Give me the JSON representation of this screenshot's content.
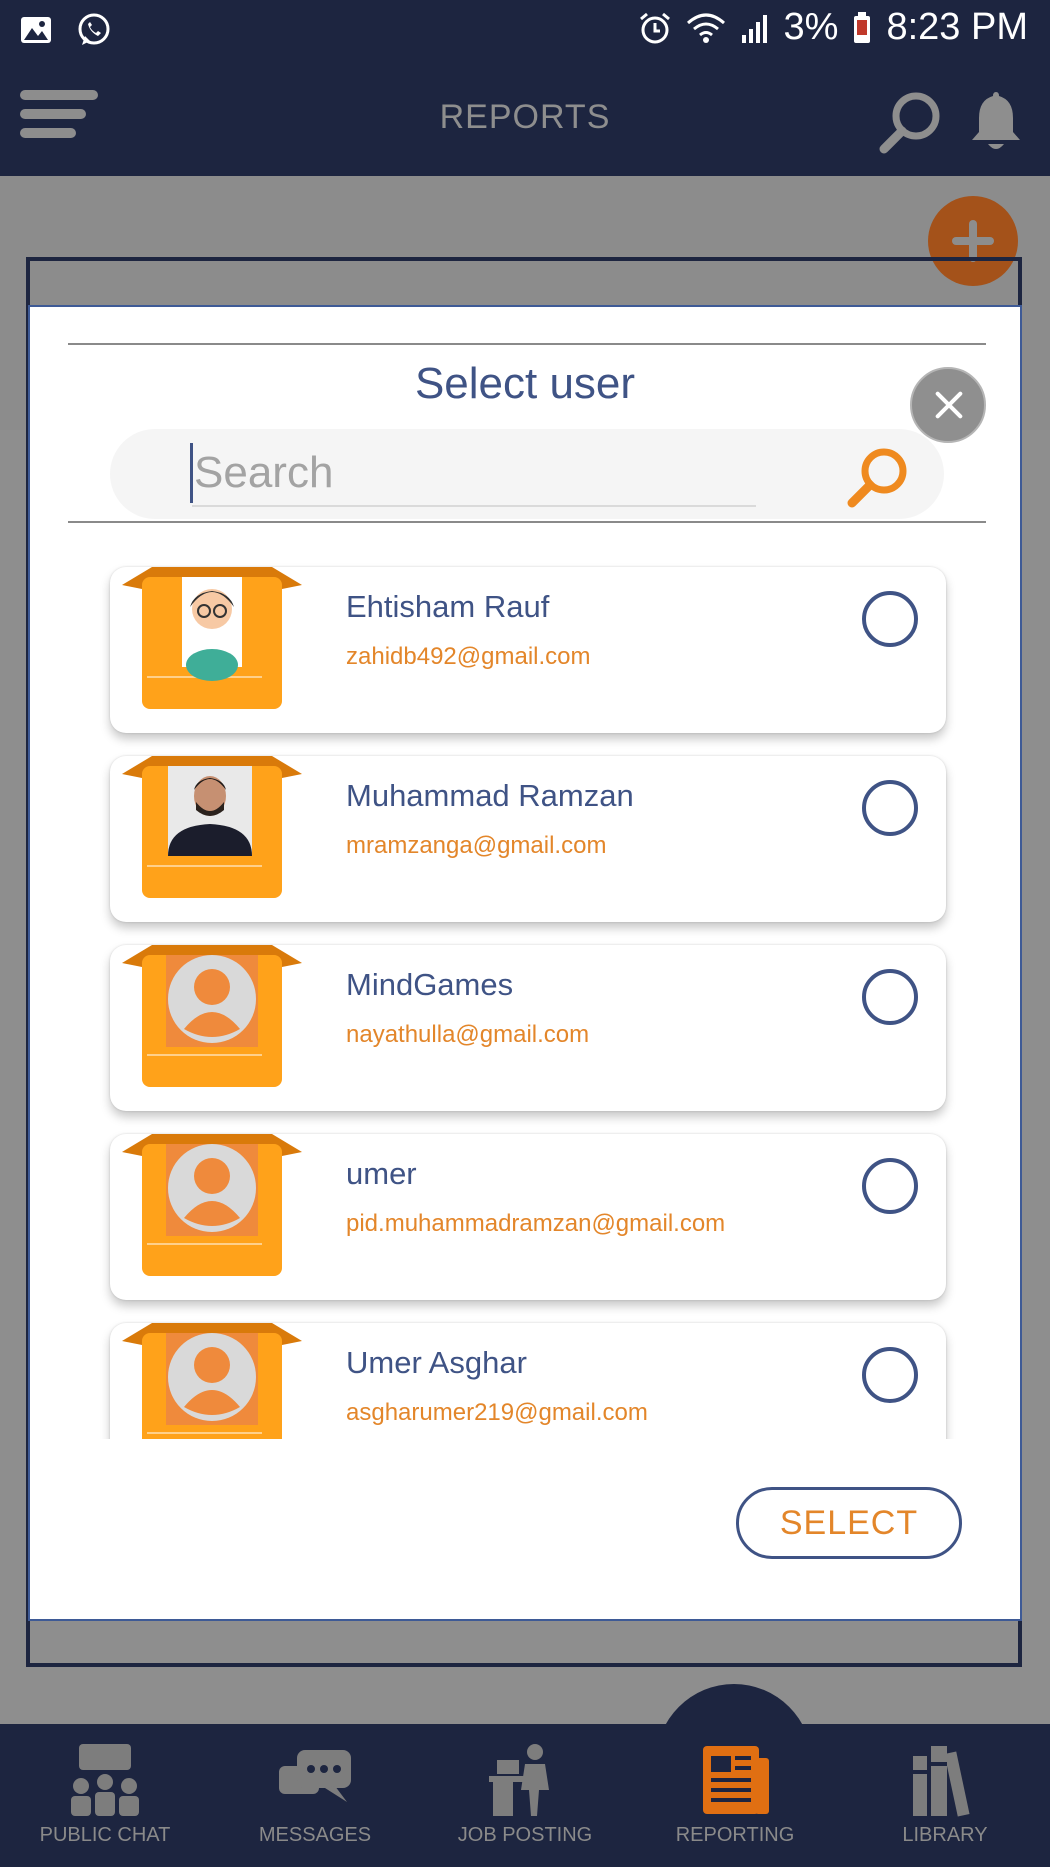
{
  "status_bar": {
    "battery": "3%",
    "time": "8:23 PM"
  },
  "app_bar": {
    "title": "REPORTS"
  },
  "modal": {
    "title": "Select user",
    "search_placeholder": "Search",
    "select_label": "SELECT",
    "users": [
      {
        "name": "Ehtisham Rauf",
        "email": "zahidb492@gmail.com",
        "avatar": "cartoon-avatar"
      },
      {
        "name": "Muhammad Ramzan",
        "email": "mramzanga@gmail.com",
        "avatar": "photo-avatar"
      },
      {
        "name": "MindGames",
        "email": "nayathulla@gmail.com",
        "avatar": "default-avatar"
      },
      {
        "name": "umer",
        "email": "pid.muhammadramzan@gmail.com",
        "avatar": "default-avatar"
      },
      {
        "name": "Umer Asghar",
        "email": "asgharumer219@gmail.com",
        "avatar": "default-avatar"
      }
    ]
  },
  "bottom_nav": {
    "items": [
      {
        "label": "PUBLIC CHAT",
        "icon": "group-chat-icon"
      },
      {
        "label": "MESSAGES",
        "icon": "messages-icon"
      },
      {
        "label": "JOB POSTING",
        "icon": "job-posting-icon"
      },
      {
        "label": "REPORTING",
        "icon": "reporting-icon",
        "active": true
      },
      {
        "label": "LIBRARY",
        "icon": "library-icon"
      }
    ]
  },
  "colors": {
    "navy": "#1d2540",
    "accent_orange": "#e3862a",
    "text_blue": "#3f5385"
  }
}
